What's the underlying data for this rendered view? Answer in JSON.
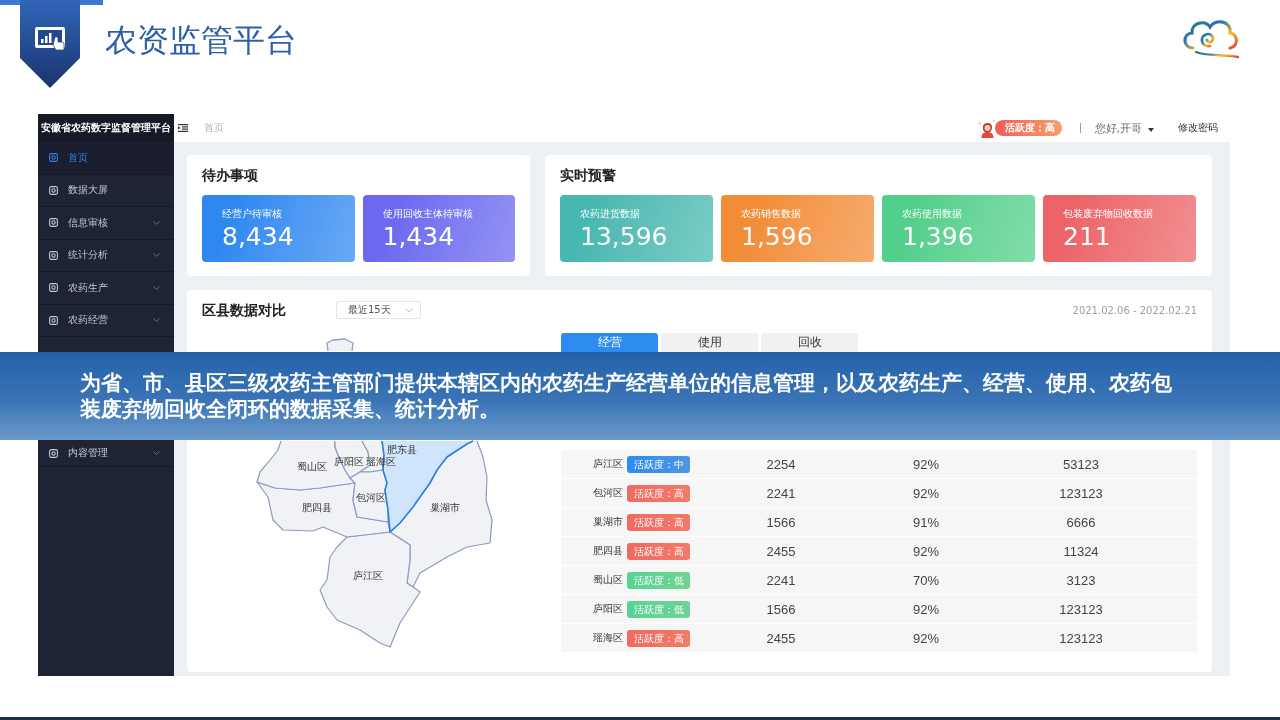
{
  "header": {
    "title": "农资监管平台"
  },
  "sidebar": {
    "title": "安徽省农药数字监督管理平台",
    "items": [
      {
        "label": "首页",
        "selected": true,
        "expandable": false
      },
      {
        "label": "数据大屏",
        "selected": false,
        "expandable": false
      },
      {
        "label": "信息审核",
        "selected": false,
        "expandable": true
      },
      {
        "label": "统计分析",
        "selected": false,
        "expandable": true
      },
      {
        "label": "农药生产",
        "selected": false,
        "expandable": true
      },
      {
        "label": "农药经营",
        "selected": false,
        "expandable": true
      }
    ],
    "lower_items": [
      {
        "label": "内容管理",
        "selected": false,
        "expandable": true
      }
    ]
  },
  "topbar": {
    "breadcrumb": "首页",
    "activity_badge": "活跃度：高",
    "greeting": "您好,开哥",
    "change_password": "修改密码"
  },
  "todo": {
    "title": "待办事项",
    "tiles": [
      {
        "label": "经营户待审核",
        "value": "8,434",
        "color": "#2f88f0"
      },
      {
        "label": "使用回收主体待审核",
        "value": "1,434",
        "color": "#6c68ef"
      }
    ]
  },
  "alerts": {
    "title": "实时预警",
    "tiles": [
      {
        "label": "农药进货数据",
        "value": "13,596",
        "color": "#47b8b0"
      },
      {
        "label": "农药销售数据",
        "value": "1,596",
        "color": "#f28c35"
      },
      {
        "label": "农药使用数据",
        "value": "1,396",
        "color": "#52cf8a"
      },
      {
        "label": "包装废弃物回收数据",
        "value": "211",
        "color": "#ec6468"
      }
    ]
  },
  "comparison": {
    "title": "区县数据对比",
    "period": "最近15天",
    "date_range": "2021.02.06 - 2022.02.21",
    "tabs": [
      {
        "label": "经营",
        "selected": true
      },
      {
        "label": "使用",
        "selected": false
      },
      {
        "label": "回收",
        "selected": false
      }
    ],
    "map": {
      "regions": [
        {
          "label": "肥东县",
          "selected": true
        },
        {
          "label": "巢湖市",
          "selected": false
        },
        {
          "label": "庐江区",
          "selected": false
        },
        {
          "label": "肥四县",
          "selected": false
        },
        {
          "label": "蜀山区",
          "selected": false
        },
        {
          "label": "庐阳区",
          "selected": false
        },
        {
          "label": "瑶海区",
          "selected": false
        },
        {
          "label": "包河区",
          "selected": false
        }
      ]
    },
    "rows": [
      {
        "column_1": "庐江区",
        "badge": {
          "text": "活跃度：中",
          "color": "#2d8cf0"
        },
        "column_2": "2254",
        "column_3": "92%",
        "column_4": "53123"
      },
      {
        "column_1": "包河区",
        "badge": {
          "text": "活跃度：高",
          "color": "#ef6b62"
        },
        "column_2": "2241",
        "column_3": "92%",
        "column_4": "123123"
      },
      {
        "column_1": "巢湖市",
        "badge": {
          "text": "活跃度：高",
          "color": "#ef6b62"
        },
        "column_2": "1566",
        "column_3": "91%",
        "column_4": "6666"
      },
      {
        "column_1": "肥四县",
        "badge": {
          "text": "活跃度：高",
          "color": "#ef6b62"
        },
        "column_2": "2455",
        "column_3": "92%",
        "column_4": "11324"
      },
      {
        "column_1": "蜀山区",
        "badge": {
          "text": "活跃度：低",
          "color": "#56d494"
        },
        "column_2": "2241",
        "column_3": "70%",
        "column_4": "3123"
      },
      {
        "column_1": "庐阳区",
        "badge": {
          "text": "活跃度：低",
          "color": "#56d494"
        },
        "column_2": "1566",
        "column_3": "92%",
        "column_4": "123123"
      },
      {
        "column_1": "瑶海区",
        "badge": {
          "text": "活跃度：高",
          "color": "#ef6b62"
        },
        "column_2": "2455",
        "column_3": "92%",
        "column_4": "123123"
      }
    ]
  },
  "banner": {
    "text": "为省、市、县区三级农药主管部门提供本辖区内的农药生产经营单位的信息管理，以及农药生产、经营、使用、农药包装废弃物回收全闭环的数据采集、统计分析。"
  }
}
